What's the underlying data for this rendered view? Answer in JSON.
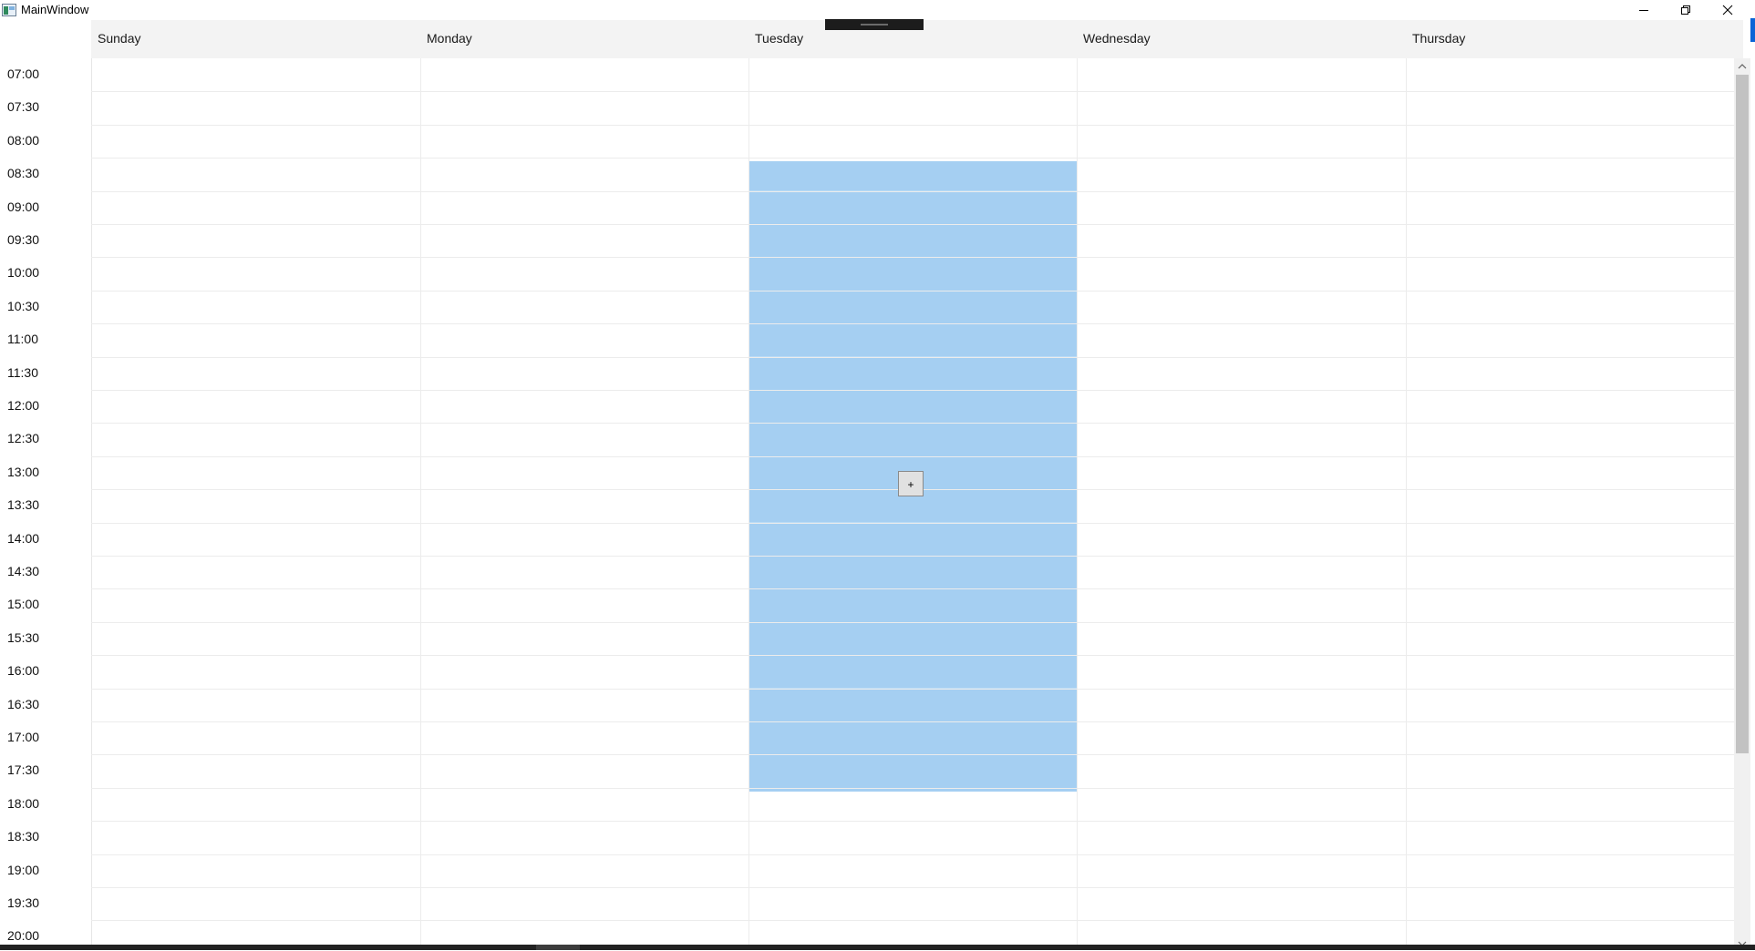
{
  "window": {
    "title": "MainWindow",
    "icons": {
      "app": "window-app-icon",
      "minimize": "minimize-icon",
      "maximize": "restore-icon",
      "close": "close-icon"
    }
  },
  "calendar": {
    "days": [
      "Sunday",
      "Monday",
      "Tuesday",
      "Wednesday",
      "Thursday"
    ],
    "times": [
      "07:00",
      "07:30",
      "08:00",
      "08:30",
      "09:00",
      "09:30",
      "10:00",
      "10:30",
      "11:00",
      "11:30",
      "12:00",
      "12:30",
      "13:00",
      "13:30",
      "14:00",
      "14:30",
      "15:00",
      "15:30",
      "16:00",
      "16:30",
      "17:00",
      "17:30",
      "18:00",
      "18:30",
      "19:00",
      "19:30",
      "20:00"
    ],
    "selection": {
      "day": "Tuesday",
      "start": "08:30",
      "end": "18:00"
    },
    "add_button_label": "+"
  },
  "colors": {
    "selection": "#a5cff2",
    "header_background": "#f3f3f3",
    "accent": "#0a64d6"
  }
}
